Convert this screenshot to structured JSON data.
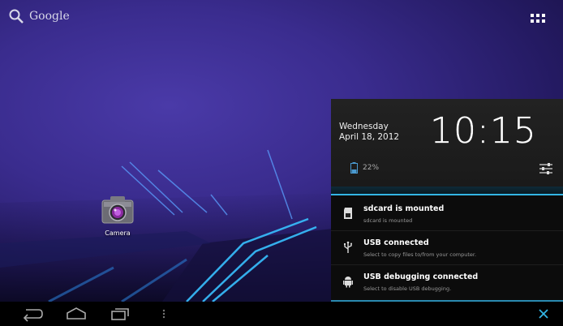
{
  "search": {
    "label": "Google"
  },
  "app": {
    "camera_label": "Camera"
  },
  "panel": {
    "date_line1": "Wednesday",
    "date_line2": "April 18, 2012",
    "time": "10:15",
    "battery": "22%",
    "notifications": [
      {
        "title": "sdcard is mounted",
        "subtitle": "sdcard is mounted",
        "icon": "sdcard-icon"
      },
      {
        "title": "USB connected",
        "subtitle": "Select to copy files to/from your computer.",
        "icon": "usb-icon"
      },
      {
        "title": "USB debugging connected",
        "subtitle": "Select to disable USB debugging.",
        "icon": "android-debug-icon"
      }
    ]
  },
  "colors": {
    "accent": "#33b5e5",
    "wallpaper": "#3a2c8e"
  }
}
